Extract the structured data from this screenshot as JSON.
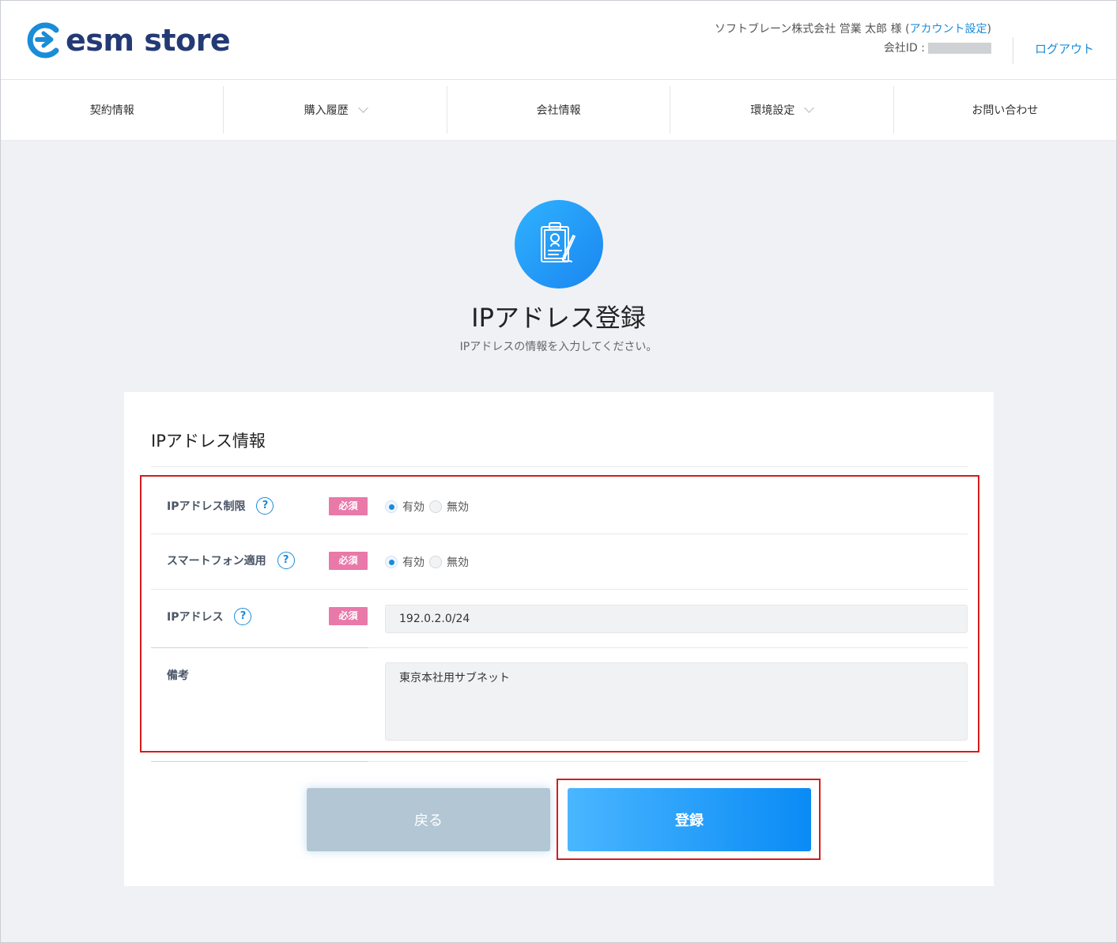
{
  "header": {
    "logo_text": "esm store",
    "user_name": "ソフトブレーン株式会社 営業 太郎 様 (",
    "account_settings": "アカウント設定",
    "user_suffix": ")",
    "company_id_label": "会社ID :",
    "logout": "ログアウト"
  },
  "nav": {
    "items": [
      {
        "label": "契約情報"
      },
      {
        "label": "購入履歴"
      },
      {
        "label": "会社情報"
      },
      {
        "label": "環境設定"
      },
      {
        "label": "お問い合わせ"
      }
    ]
  },
  "page": {
    "title": "IPアドレス登録",
    "subtitle": "IPアドレスの情報を入力してください。"
  },
  "form": {
    "section_title": "IPアドレス情報",
    "required_badge": "必須",
    "help_mark": "?",
    "ip_restriction": {
      "label": "IPアドレス制限",
      "options": [
        "有効",
        "無効"
      ],
      "selected": "有効"
    },
    "smartphone": {
      "label": "スマートフォン適用",
      "options": [
        "有効",
        "無効"
      ],
      "selected": "有効"
    },
    "ip_address": {
      "label": "IPアドレス",
      "value": "192.0.2.0/24"
    },
    "note": {
      "label": "備考",
      "value": "東京本社用サブネット"
    }
  },
  "buttons": {
    "back": "戻る",
    "submit": "登録"
  },
  "colors": {
    "accent": "#1a8cd8",
    "required": "#e879a9",
    "highlight": "#d41c1c",
    "brand": "#233a75"
  }
}
